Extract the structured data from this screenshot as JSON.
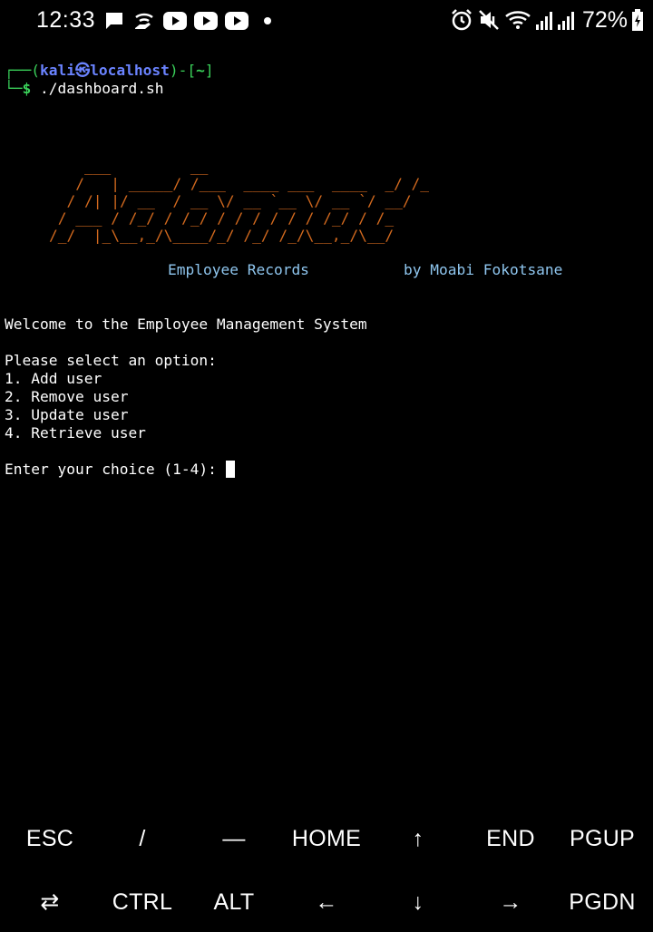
{
  "status_bar": {
    "time": "12:33",
    "notification_icons": [
      "message-icon",
      "wifi-share-icon",
      "youtube-icon",
      "youtube-icon",
      "youtube-icon",
      "more-dot-icon"
    ],
    "system_icons": [
      "alarm-icon",
      "mute-icon",
      "wifi-icon",
      "signal-icon",
      "signal-icon"
    ],
    "battery": "72%"
  },
  "terminal": {
    "prompt_top": "┌──(",
    "prompt_user": "kali㉿localhost",
    "prompt_mid": ")-[",
    "prompt_dir": "~",
    "prompt_end": "]",
    "prompt_bottom": "└─$",
    "command": "./dashboard.sh",
    "banner_ascii": "        ___         __\n       /   | _____/ /___  ____ ___  ____  _/ /_\n      / /| |/ __  / __ \\/ __ `__ \\/ __ `/ __/\n     / ___ / /_/ / /_/ / / / / / / /_/ / /_\n    /_/  |_\\__,_/\\____/_/ /_/ /_/\\__,_/\\__/",
    "subtitle_left": "Employee Records",
    "subtitle_right": "by Moabi Fokotsane",
    "welcome": "Welcome to the Employee Management System",
    "select_prompt": "Please select an option:",
    "options": [
      "1. Add user",
      "2. Remove user",
      "3. Update user",
      "4. Retrieve user"
    ],
    "input_prompt": "Enter your choice (1-4): "
  },
  "extra_keys": {
    "row1": [
      "ESC",
      "/",
      "—",
      "HOME",
      "↑",
      "END",
      "PGUP"
    ],
    "row2": [
      "⇄",
      "CTRL",
      "ALT",
      "←",
      "↓",
      "→",
      "PGDN"
    ]
  }
}
